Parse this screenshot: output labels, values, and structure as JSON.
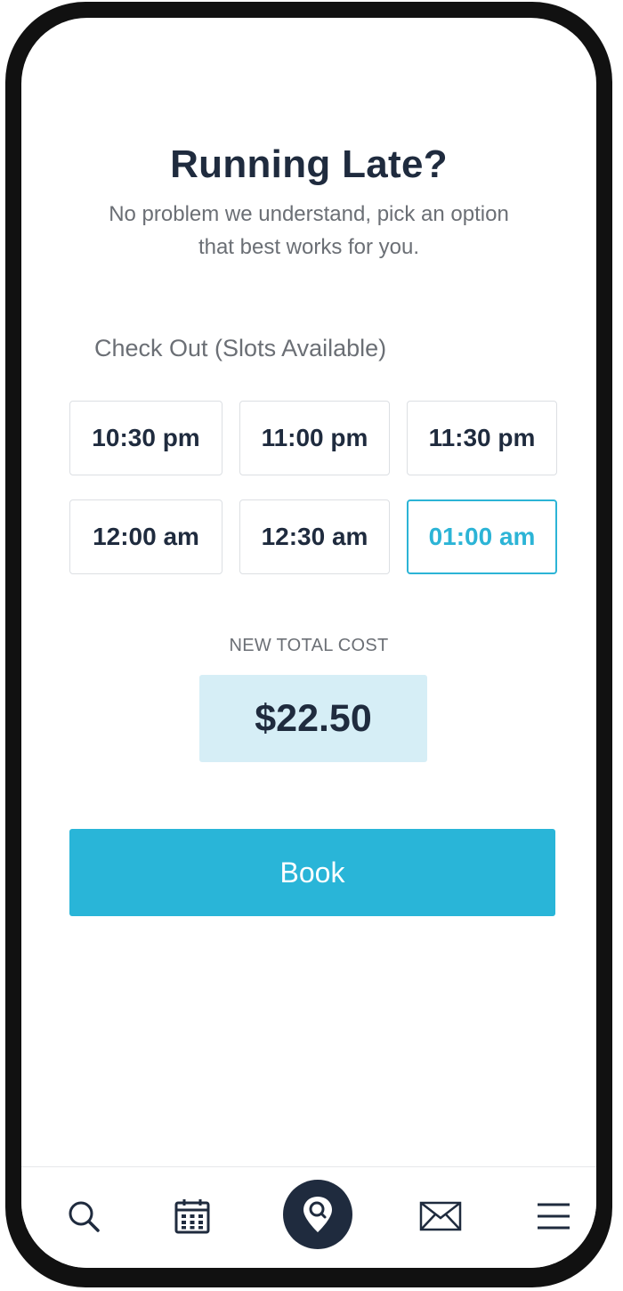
{
  "header": {
    "title": "Running Late?",
    "subtitle": "No problem we understand, pick an option that best works for you."
  },
  "slots": {
    "label": "Check Out (Slots Available)",
    "items": [
      {
        "label": "10:30 pm",
        "selected": false
      },
      {
        "label": "11:00 pm",
        "selected": false
      },
      {
        "label": "11:30 pm",
        "selected": false
      },
      {
        "label": "12:00 am",
        "selected": false
      },
      {
        "label": "12:30 am",
        "selected": false
      },
      {
        "label": "01:00 am",
        "selected": true
      }
    ]
  },
  "cost": {
    "label": "NEW TOTAL COST",
    "value": "$22.50"
  },
  "book": {
    "label": "Book"
  },
  "nav": {
    "items": [
      {
        "icon": "search-icon"
      },
      {
        "icon": "calendar-icon"
      },
      {
        "icon": "location-search-icon",
        "active": true
      },
      {
        "icon": "mail-icon"
      },
      {
        "icon": "menu-icon"
      }
    ]
  },
  "colors": {
    "accent": "#29b5d8",
    "dark": "#1f2b3e",
    "cost_bg": "#d6eef6"
  }
}
